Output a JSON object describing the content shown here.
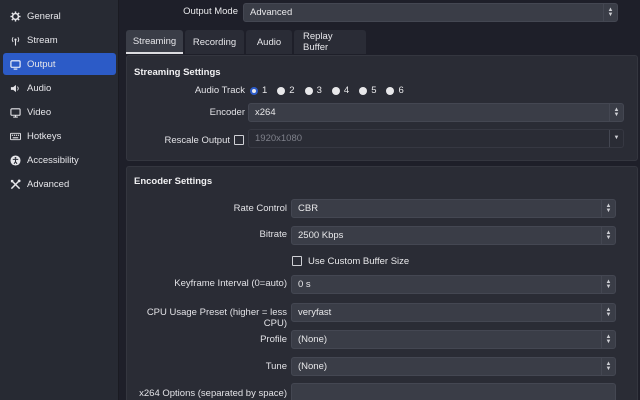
{
  "sidebar": {
    "items": [
      {
        "label": "General",
        "icon": "gear-icon"
      },
      {
        "label": "Stream",
        "icon": "antenna-icon"
      },
      {
        "label": "Output",
        "icon": "monitor-output-icon"
      },
      {
        "label": "Audio",
        "icon": "speaker-icon"
      },
      {
        "label": "Video",
        "icon": "display-icon"
      },
      {
        "label": "Hotkeys",
        "icon": "keyboard-icon"
      },
      {
        "label": "Accessibility",
        "icon": "accessibility-icon"
      },
      {
        "label": "Advanced",
        "icon": "tools-icon"
      }
    ],
    "active": "Output",
    "accent": "#2c5bc7"
  },
  "output_mode": {
    "label": "Output Mode",
    "value": "Advanced"
  },
  "tabs": [
    "Streaming",
    "Recording",
    "Audio",
    "Replay Buffer"
  ],
  "active_tab": "Streaming",
  "streaming": {
    "title": "Streaming Settings",
    "audio_track_label": "Audio Track",
    "audio_tracks": [
      "1",
      "2",
      "3",
      "4",
      "5",
      "6"
    ],
    "selected_track": "1",
    "encoder_label": "Encoder",
    "encoder_value": "x264",
    "rescale_label": "Rescale Output",
    "rescale_value": "1920x1080"
  },
  "encoder": {
    "title": "Encoder Settings",
    "rate_control_label": "Rate Control",
    "rate_control_value": "CBR",
    "bitrate_label": "Bitrate",
    "bitrate_value": "2500 Kbps",
    "custom_buffer_label": "Use Custom Buffer Size",
    "keyframe_label": "Keyframe Interval (0=auto)",
    "keyframe_value": "0 s",
    "cpu_preset_label": "CPU Usage Preset (higher = less CPU)",
    "cpu_preset_value": "veryfast",
    "profile_label": "Profile",
    "profile_value": "(None)",
    "tune_label": "Tune",
    "tune_value": "(None)",
    "x264_options_label": "x264 Options (separated by space)",
    "x264_options_value": ""
  }
}
